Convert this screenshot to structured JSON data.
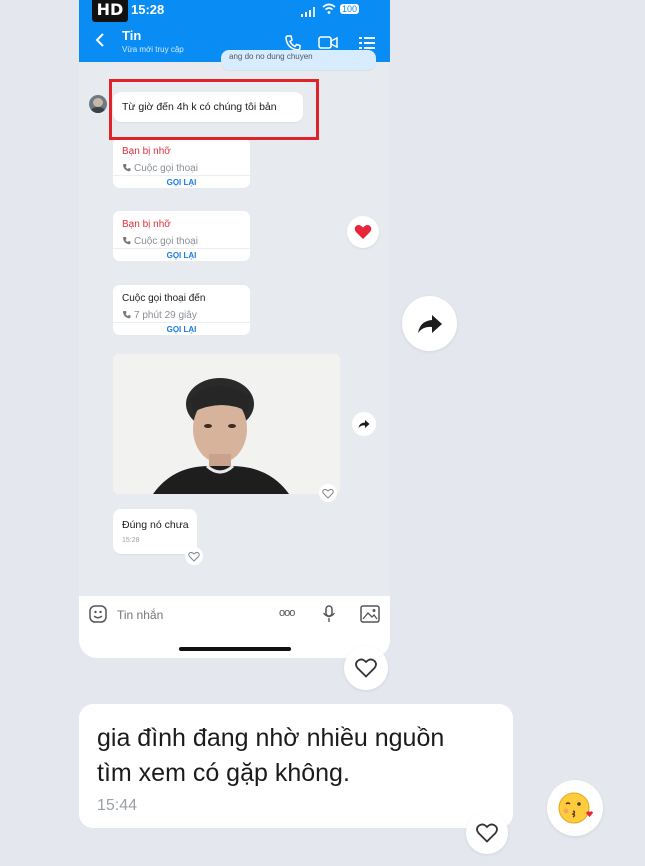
{
  "status": {
    "badge": "HD",
    "time": "15:28",
    "battery": "100"
  },
  "header": {
    "title": "Tin",
    "subtitle": "Vừa mới truy cập"
  },
  "top_partial": {
    "text": "ang do no dung chuyen"
  },
  "messages": [
    {
      "id": "highlighted",
      "text": "Từ giờ đến 4h k có chúng tôi bản"
    }
  ],
  "call_cards": [
    {
      "title": "Bạn bị nhỡ",
      "subtitle": "Cuộc gọi thoại",
      "button": "GỌI LẠI",
      "missed": true
    },
    {
      "title": "Bạn bị nhỡ",
      "subtitle": "Cuộc gọi thoại",
      "button": "GỌI LẠI",
      "missed": true
    },
    {
      "title": "Cuộc gọi thoại đến",
      "subtitle": "7 phút 29 giây",
      "button": "GỌI LẠI",
      "missed": false
    }
  ],
  "reply": {
    "text": "Đúng nó chưa",
    "time": "15:28"
  },
  "input": {
    "placeholder": "Tin nhắn",
    "more": "ooo"
  },
  "outer_message": {
    "text_line1": "gia đình đang nhờ nhiều nguồn",
    "text_line2": "tìm xem có gặp không.",
    "time": "15:44"
  },
  "colors": {
    "accent": "#0a8cf5",
    "missed": "#e0303a",
    "highlight_box": "#e0222a",
    "link": "#1a7be0"
  },
  "icons": [
    "back-icon",
    "phone-icon",
    "video-icon",
    "menu-icon",
    "share-icon",
    "heart-icon",
    "sticker-icon",
    "mic-icon",
    "image-icon",
    "emoji-kiss-icon"
  ]
}
